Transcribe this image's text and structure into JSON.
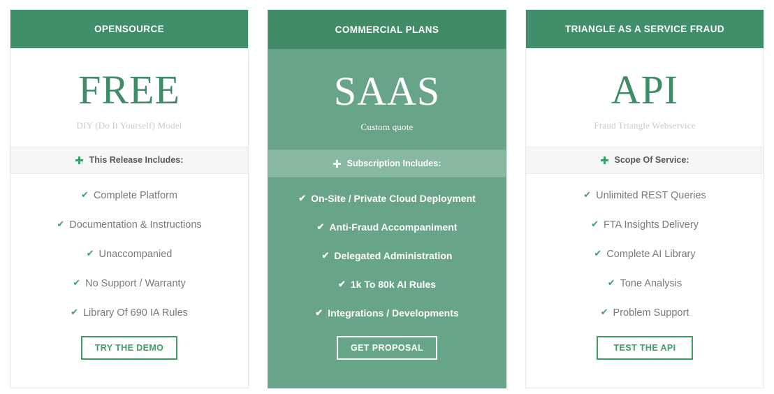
{
  "icons": {
    "check": "✔",
    "plus": "plus-icon"
  },
  "colors": {
    "header_green": "#418f68",
    "featured_body_green": "#68a588",
    "featured_band_green": "#89b8a1",
    "accent_green": "#3f9e68",
    "band_gray": "#f6f6f6",
    "feature_text_gray": "#7a7a7a",
    "subtitle_gray": "#c9c9c9"
  },
  "plans": [
    {
      "id": "opensource",
      "featured": false,
      "header": "OPENSOURCE",
      "price": "FREE",
      "price_sub": "DIY (Do It Yourself) Model",
      "includes_label": "This Release Includes:",
      "features": [
        "Complete Platform",
        "Documentation & Instructions",
        "Unaccompanied",
        "No Support / Warranty",
        "Library Of 690 IA Rules"
      ],
      "cta": "TRY THE DEMO"
    },
    {
      "id": "commercial",
      "featured": true,
      "header": "COMMERCIAL PLANS",
      "price": "SAAS",
      "price_sub": "Custom quote",
      "includes_label": "Subscription Includes:",
      "features": [
        "On-Site / Private Cloud Deployment",
        "Anti-Fraud Accompaniment",
        "Delegated Administration",
        "1k To 80k AI Rules",
        "Integrations / Developments"
      ],
      "cta": "GET PROPOSAL"
    },
    {
      "id": "api",
      "featured": false,
      "header": "TRIANGLE AS A SERVICE FRAUD",
      "price": "API",
      "price_sub": "Fraud Triangle Webservice",
      "includes_label": "Scope Of Service:",
      "features": [
        "Unlimited REST Queries",
        "FTA Insights Delivery",
        "Complete AI Library",
        "Tone Analysis",
        "Problem Support"
      ],
      "cta": "TEST THE API"
    }
  ]
}
